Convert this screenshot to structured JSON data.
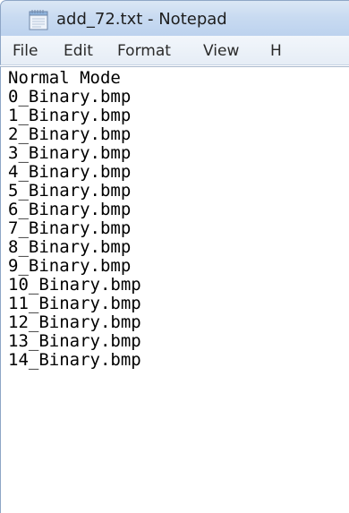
{
  "window": {
    "title": "add_72.txt - Notepad",
    "app_icon": "notepad-icon"
  },
  "menu": {
    "items": [
      "File",
      "Edit",
      "Format",
      "View",
      "H"
    ]
  },
  "editor": {
    "lines": [
      "Normal Mode",
      "0_Binary.bmp",
      "1_Binary.bmp",
      "2_Binary.bmp",
      "3_Binary.bmp",
      "4_Binary.bmp",
      "5_Binary.bmp",
      "6_Binary.bmp",
      "7_Binary.bmp",
      "8_Binary.bmp",
      "9_Binary.bmp",
      "10_Binary.bmp",
      "11_Binary.bmp",
      "12_Binary.bmp",
      "13_Binary.bmp",
      "14_Binary.bmp"
    ]
  }
}
